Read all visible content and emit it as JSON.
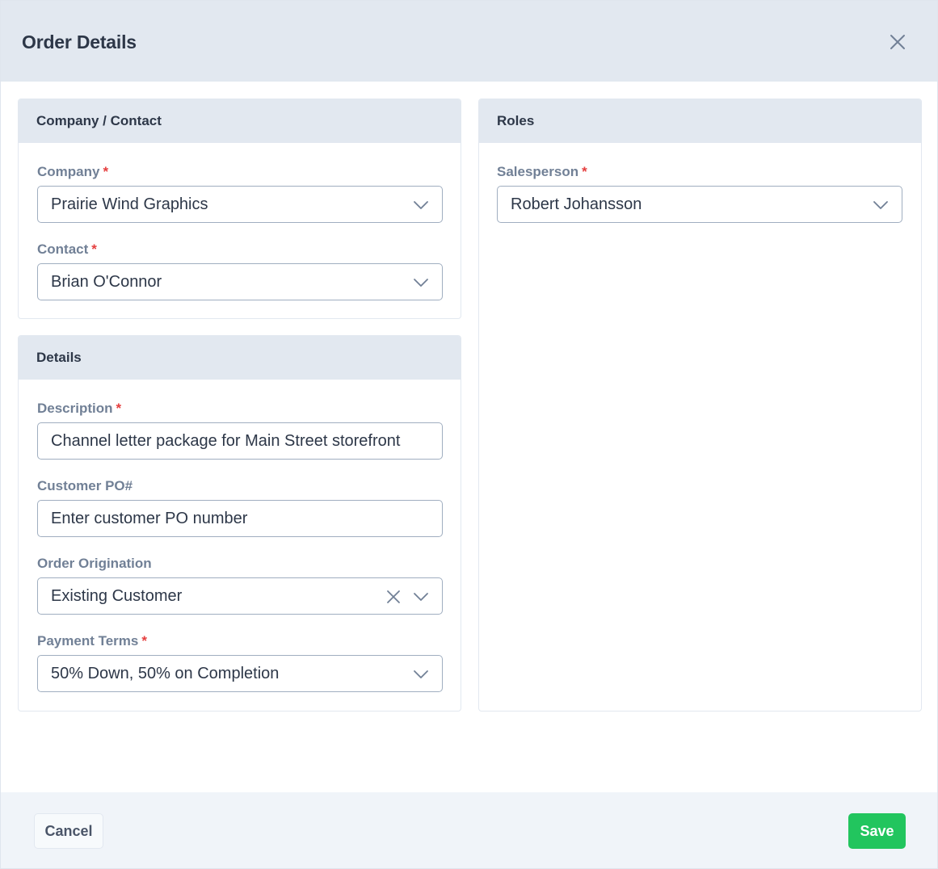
{
  "dialog": {
    "title": "Order Details"
  },
  "company_contact": {
    "heading": "Company / Contact",
    "company_label": "Company",
    "company_value": "Prairie Wind Graphics",
    "contact_label": "Contact",
    "contact_value": "Brian O'Connor",
    "required_marker": "*"
  },
  "details": {
    "heading": "Details",
    "description_label": "Description",
    "description_value": "Channel letter package for Main Street storefront",
    "customer_po_label": "Customer PO#",
    "customer_po_placeholder": "Enter customer PO number",
    "order_origination_label": "Order Origination",
    "order_origination_value": "Existing Customer",
    "payment_terms_label": "Payment Terms",
    "payment_terms_value": "50% Down, 50% on Completion"
  },
  "roles": {
    "heading": "Roles",
    "salesperson_label": "Salesperson",
    "salesperson_value": "Robert Johansson"
  },
  "footer": {
    "cancel_label": "Cancel",
    "save_label": "Save"
  },
  "colors": {
    "header_bg": "#e2e8f0",
    "required": "#e53e3e",
    "save_button": "#22c55e",
    "footer_bg": "#f0f4f9"
  },
  "icons": {
    "close": "close-icon",
    "dropdown": "chevron-down-icon",
    "clear": "clear-icon"
  }
}
